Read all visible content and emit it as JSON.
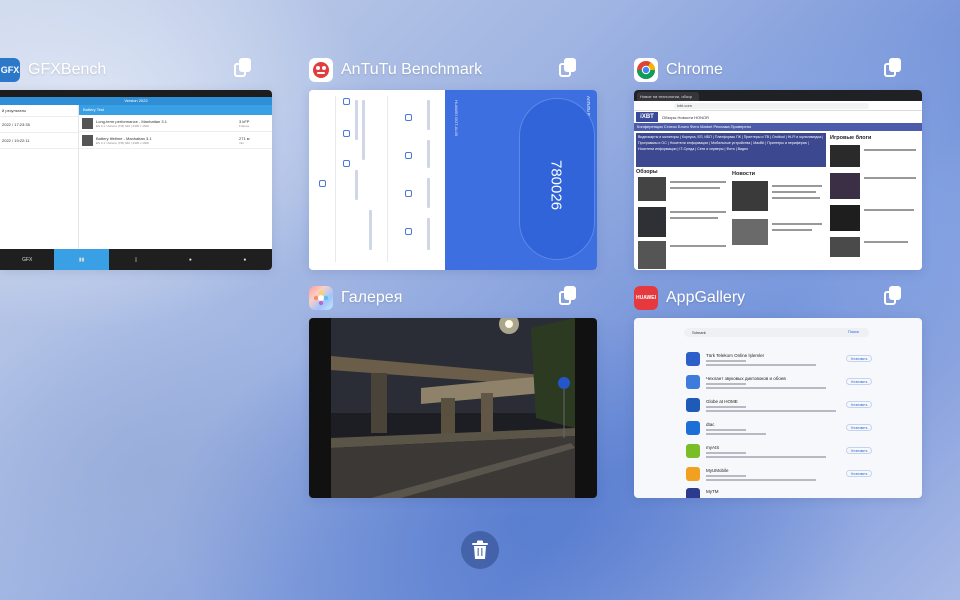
{
  "apps": {
    "gfx": {
      "title": "GFXBench",
      "icon_text": "GFX",
      "thumb": {
        "tab_title": "Version 2022",
        "side_header": "й результаты",
        "side_rows": [
          "2022 / 17:23:35",
          "2022 / 19:22:11"
        ],
        "main_header": "Battery Test",
        "rows": [
          {
            "name": "Long-term performance - Manhattan 3.1",
            "sub": "ES 3.1 / Adreno (TM) 640 | 2400 x 1600",
            "value": "3 kFP",
            "unit": "Frames"
          },
          {
            "name": "Battery lifetime - Manhattan 3.1",
            "sub": "ES 3.1 / Adreno (TM) 640 | 2400 x 1600",
            "value": "271 м",
            "unit": "min"
          }
        ],
        "nav": [
          "GFX",
          "",
          "",
          "",
          ""
        ]
      }
    },
    "antutu": {
      "title": "AnTuTu Benchmark",
      "thumb": {
        "score": "780026",
        "device": "HUAWEI GOT-AL09",
        "app_label": "AnTuTu Benchmark V9.4.4"
      }
    },
    "chrome": {
      "title": "Chrome",
      "thumb": {
        "tab_title": "Новое на технологии, обзор",
        "url": "ixbt.com",
        "logo": "iXBT",
        "nav": "Обзоры   Новости   HONOR",
        "menu": "Конференции   Статьи   Блоги   Фото   Market   Реклама   Проверено",
        "categories": "Видеокарты и мониторы | Корпуса, БП, ИБП | Платформы ПК | Принтеры и ТВ | Ondbod | Hi-Fi и мультимедиа | Программы и ОС | Носители информации | Мобильные устройства | MacBit | Принтеры и периферия | Носители информации | IT-Среда | Сети и серверы | Фото | Видео",
        "reviews_heading": "Обзоры",
        "news_heading": "Новости",
        "blogs_heading": "Игровые блоги"
      }
    },
    "gallery": {
      "title": "Галерея"
    },
    "appgallery": {
      "title": "AppGallery",
      "icon_text": "HUAWEI",
      "thumb": {
        "search_text": "Sdmark",
        "search_btn": "Поиск",
        "items": [
          {
            "name": "Türk Telekom Online İşlemler",
            "btn": "Установить",
            "color": "#2c5fc9"
          },
          {
            "name": "Чехлант звуковых диктовоков и обоев",
            "btn": "Установить",
            "color": "#3d7bdc"
          },
          {
            "name": "Globe at HOME",
            "btn": "Установить",
            "color": "#1e5ab8"
          },
          {
            "name": "dtac",
            "btn": "Установить",
            "color": "#1d6fd8"
          },
          {
            "name": "myAIS",
            "btn": "Установить",
            "color": "#7bbd27"
          },
          {
            "name": "MyUMobile",
            "btn": "Установить",
            "color": "#f1a020"
          },
          {
            "name": "MyTM",
            "btn": "Установить",
            "color": "#2b3a8c"
          }
        ]
      }
    }
  },
  "actions": {
    "clear_all_label": "clear all"
  }
}
